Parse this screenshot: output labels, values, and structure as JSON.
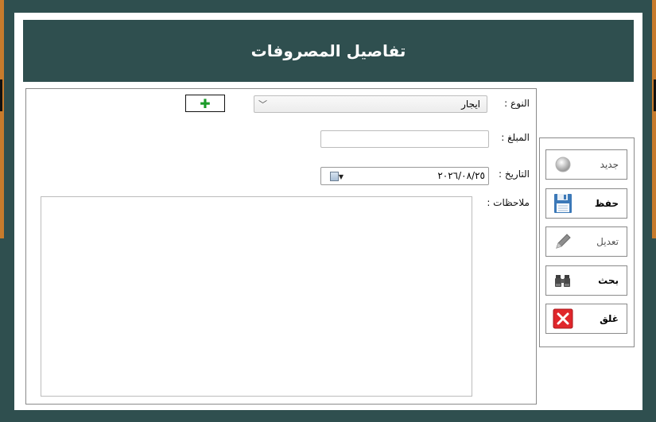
{
  "header": {
    "title": "تفاصيل المصروفات"
  },
  "form": {
    "type_label": "النوع :",
    "type_value": "ايجار",
    "add_symbol": "✚",
    "amount_label": "المبلغ :",
    "amount_value": "",
    "date_label": "التاريخ :",
    "date_value": "٢٠٢٦/٠٨/٢٥",
    "notes_label": "ملاحظات :",
    "notes_value": ""
  },
  "actions": [
    {
      "label": "جديد",
      "icon": "new-circle-icon"
    },
    {
      "label": "حفظ",
      "icon": "save-floppy-icon"
    },
    {
      "label": "تعديل",
      "icon": "edit-pencil-icon"
    },
    {
      "label": "بحث",
      "icon": "binoculars-icon"
    },
    {
      "label": "غلق",
      "icon": "close-x-icon"
    }
  ],
  "colors": {
    "header_bg": "#2f4f4f",
    "add_plus": "#1c9b2a",
    "close_red": "#e0262b"
  }
}
